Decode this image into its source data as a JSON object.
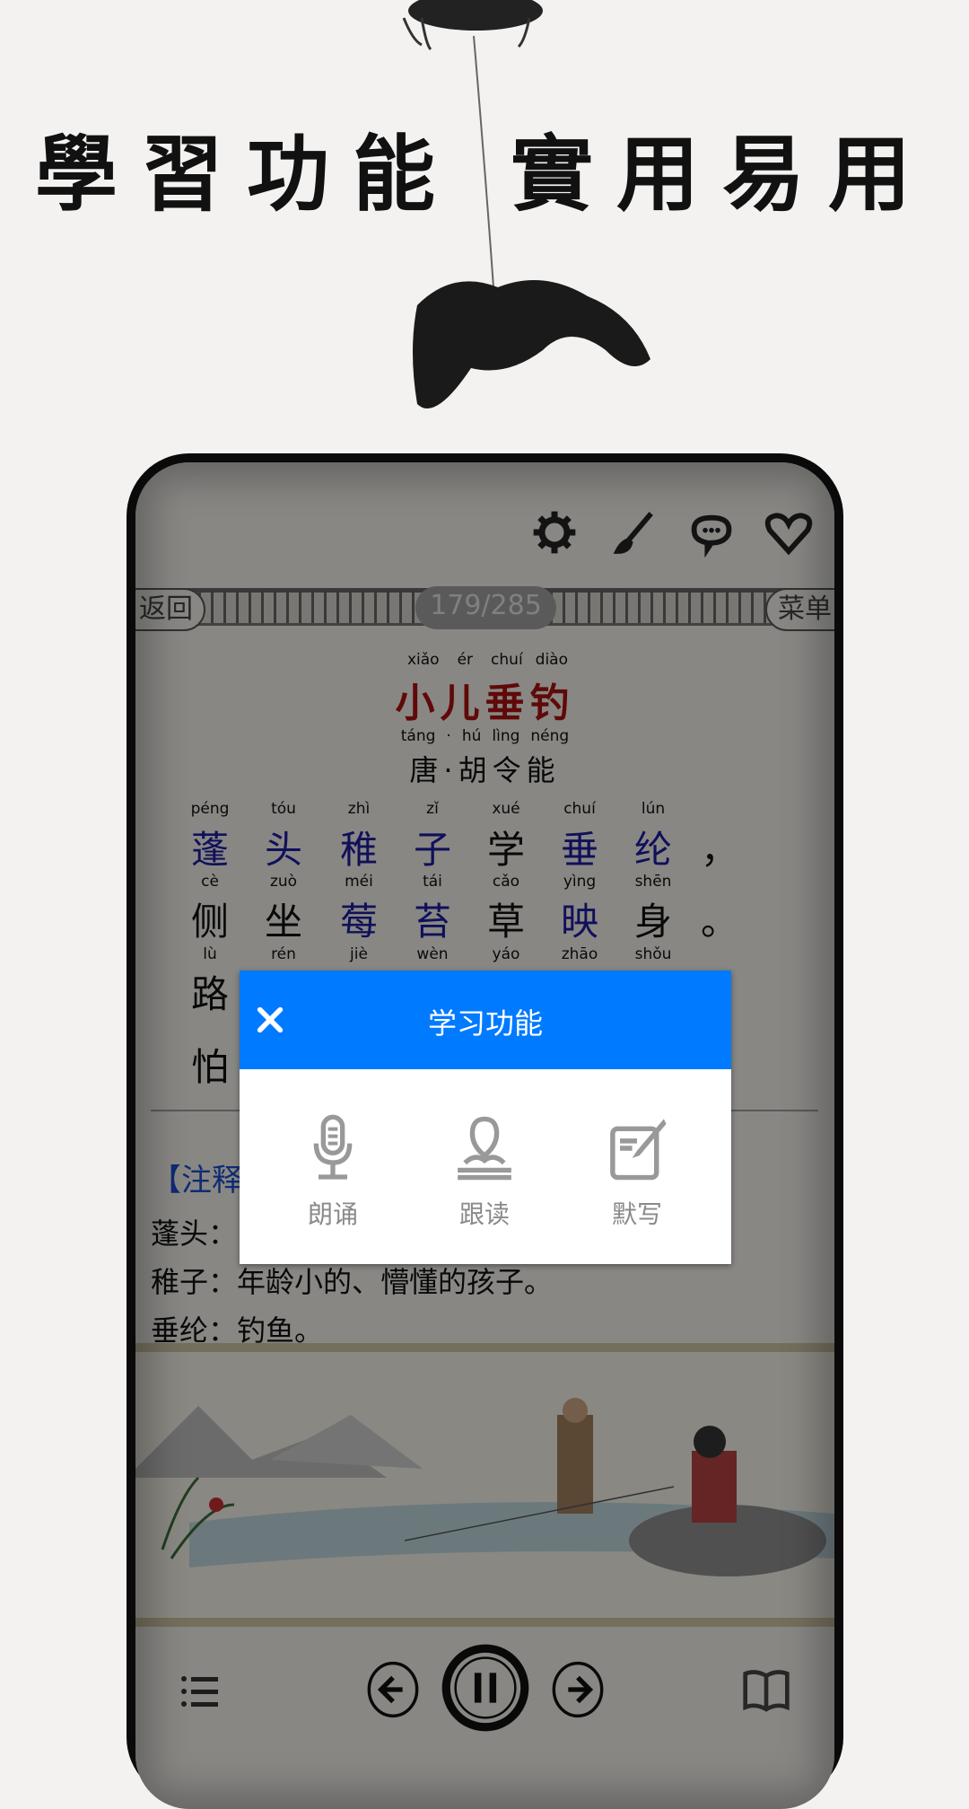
{
  "headline": "學習功能 實用易用",
  "app": {
    "top_icons": [
      "gear-icon",
      "brush-icon",
      "comment-icon",
      "heart-icon"
    ],
    "back_label": "返回",
    "page_counter": "179/285",
    "menu_label": "菜单",
    "poem": {
      "title_pinyin": [
        "xiǎo",
        "ér",
        "chuí",
        "diào"
      ],
      "title": "小儿垂钓",
      "author_pinyin": [
        "táng",
        "·",
        "hú",
        "lìng",
        "néng"
      ],
      "author": "唐·胡令能",
      "lines": [
        {
          "pinyin": [
            "péng",
            "tóu",
            "zhì",
            "zǐ",
            "xué",
            "chuí",
            "lún"
          ],
          "chars": [
            "蓬",
            "头",
            "稚",
            "子",
            "学",
            "垂",
            "纶"
          ],
          "highlight": [
            true,
            true,
            true,
            true,
            false,
            true,
            true
          ],
          "punct": "，"
        },
        {
          "pinyin": [
            "cè",
            "zuò",
            "méi",
            "tái",
            "cǎo",
            "yìng",
            "shēn"
          ],
          "chars": [
            "侧",
            "坐",
            "莓",
            "苔",
            "草",
            "映",
            "身"
          ],
          "highlight": [
            false,
            false,
            true,
            true,
            false,
            true,
            false
          ],
          "punct": "。"
        },
        {
          "pinyin": [
            "lù",
            "rén",
            "jiè",
            "wèn",
            "yáo",
            "zhāo",
            "shǒu"
          ],
          "chars": [
            "路"
          ],
          "highlight": [
            false
          ],
          "punct": "，"
        },
        {
          "pinyin": [],
          "chars": [
            "怕"
          ],
          "highlight": [
            false
          ],
          "punct": "。"
        }
      ]
    },
    "notes": {
      "heading": "【注释】",
      "items": [
        "蓬头：",
        "稚子：年龄小的、懵懂的孩子。",
        "垂纶：钓鱼。"
      ]
    },
    "bottom_bar": [
      "list-icon",
      "previous-icon",
      "pause-icon",
      "next-icon",
      "book-icon"
    ]
  },
  "modal": {
    "title": "学习功能",
    "accent": "#007AFF",
    "items": [
      {
        "icon": "microphone-icon",
        "label": "朗诵"
      },
      {
        "icon": "reader-icon",
        "label": "跟读"
      },
      {
        "icon": "edit-note-icon",
        "label": "默写"
      }
    ]
  }
}
